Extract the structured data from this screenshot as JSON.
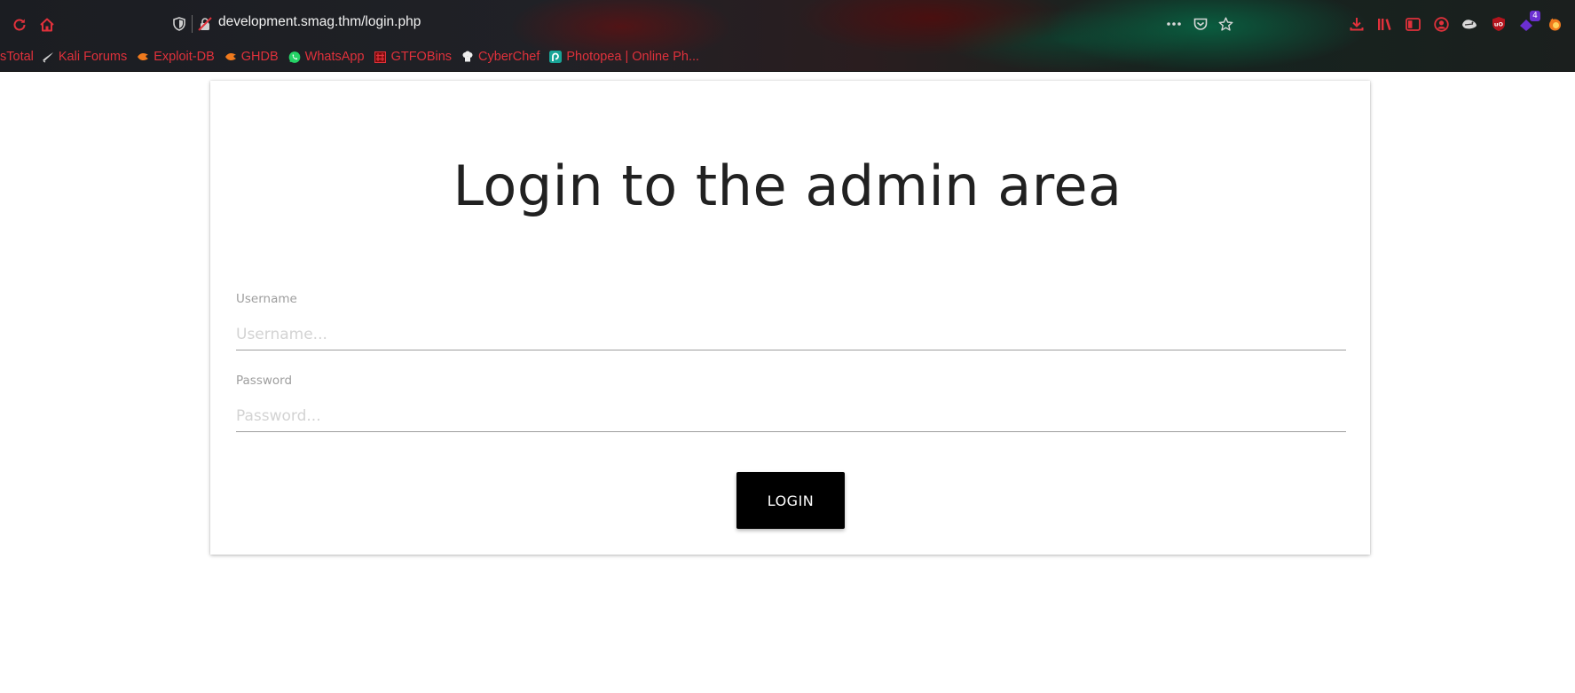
{
  "browser": {
    "url": "development.smag.thm/login.php",
    "accent_color": "#e0313b",
    "toolbar_left": [
      {
        "name": "reload-icon"
      },
      {
        "name": "home-icon"
      }
    ],
    "toolbar_right": [
      {
        "name": "more-actions-icon"
      },
      {
        "name": "pocket-icon"
      },
      {
        "name": "bookmark-star-icon"
      },
      {
        "name": "downloads-icon"
      },
      {
        "name": "library-icon"
      },
      {
        "name": "sidebar-icon"
      },
      {
        "name": "account-icon"
      },
      {
        "name": "extension-icon"
      },
      {
        "name": "ublock-icon"
      },
      {
        "name": "extension-badge-icon",
        "badge": "4"
      },
      {
        "name": "firefox-extension-icon"
      }
    ],
    "bookmarks": [
      {
        "label": "sTotal",
        "icon": ""
      },
      {
        "label": "Kali Forums",
        "icon": "kali-icon"
      },
      {
        "label": "Exploit-DB",
        "icon": "exploit-db-icon"
      },
      {
        "label": "GHDB",
        "icon": "ghdb-icon"
      },
      {
        "label": "WhatsApp",
        "icon": "whatsapp-icon"
      },
      {
        "label": "GTFOBins",
        "icon": "gtfobins-icon"
      },
      {
        "label": "CyberChef",
        "icon": "cyberchef-icon"
      },
      {
        "label": "Photopea | Online Ph...",
        "icon": "photopea-icon"
      }
    ]
  },
  "page": {
    "title": "Login to the admin area",
    "username": {
      "label": "Username",
      "placeholder": "Username...",
      "value": ""
    },
    "password": {
      "label": "Password",
      "placeholder": "Password...",
      "value": ""
    },
    "login_button": "LOGIN"
  }
}
